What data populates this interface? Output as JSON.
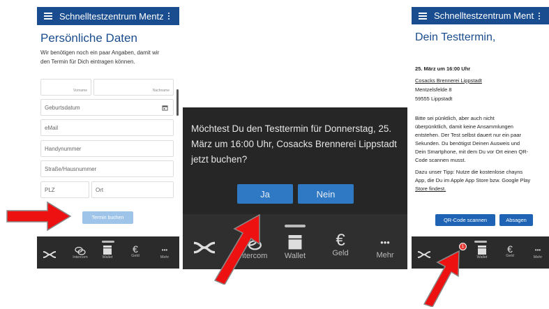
{
  "app": {
    "title": "Schnelltestzentrum Mentz...",
    "title_p3": "Schnelltestzentrum Mentz..."
  },
  "screen1": {
    "heading": "Persönliche Daten",
    "intro_line1": "Wir benötigen noch ein paar Angaben, damit wir",
    "intro_line2": "den Termin für Dich eintragen können.",
    "fields": {
      "vorname": "Vorname",
      "nachname": "Nachname",
      "geburtsdatum": "Geburtsdatum",
      "email": "eMail",
      "handy": "Handynummer",
      "strasse": "Straße/Hausnummer",
      "plz": "PLZ",
      "ort": "Ort"
    },
    "book_button": "Termin buchen"
  },
  "screen2": {
    "dialog_text": "Möchtest Du den Testtermin für Donnerstag, 25. März um 16:00 Uhr, Cosacks Brennerei Lippstadt jetzt buchen?",
    "yes": "Ja",
    "no": "Nein"
  },
  "screen3": {
    "heading": "Dein Testtermin,",
    "datetime": "25. März um 16:00 Uhr",
    "location_name": "Cosacks Brennerei Lippstadt",
    "street": "Mentzelsfelde 8",
    "city": "59555 Lippstadt",
    "para1_l1": "Bitte sei pünktlich, aber auch nicht",
    "para1_l2": "überpünktlich, damit keine Ansammlungen",
    "para1_l3": "entstehen. Der Test selbst dauert nur ein paar",
    "para1_l4": "Sekunden. Du benötigst Deinen Ausweis und",
    "para1_l5": "Dein Smartphone, mit dem Du vor Ort einen QR-",
    "para1_l6": "Code scannen musst.",
    "para2_l1": "Dazu unser Tipp: Nutze die kostenlose chayns",
    "para2_l2": "App, die Du im Apple App Store bzw. Google Play",
    "para2_l3": "Store findest.",
    "qr_button": "QR-Code scannen",
    "cancel_button": "Absagen",
    "badge_count": "1"
  },
  "tabbar": {
    "intercom": "Intercom",
    "wallet": "Wallet",
    "geld": "Geld",
    "mehr": "Mehr",
    "euro_glyph": "€",
    "more_glyph": "•••"
  },
  "colors": {
    "primary": "#1a4d8f",
    "button": "#2f78c4",
    "arrow": "#ee1111"
  }
}
